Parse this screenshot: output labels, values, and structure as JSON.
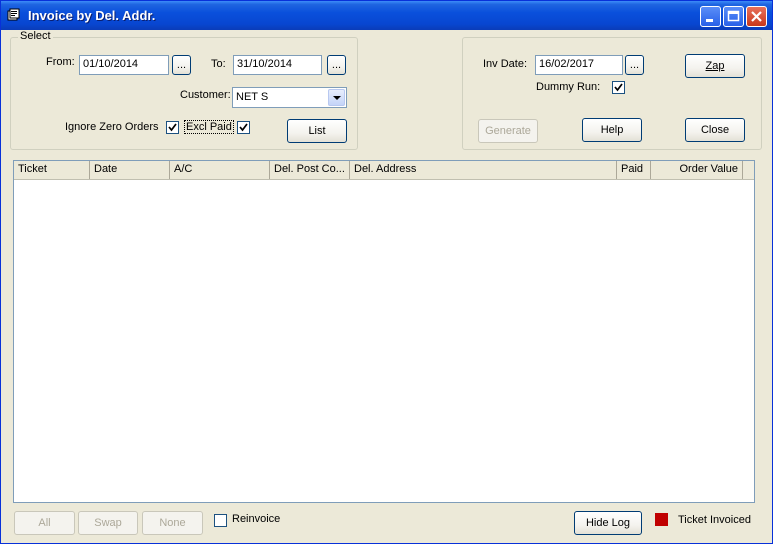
{
  "window": {
    "title": "Invoice by Del. Addr."
  },
  "select_group": {
    "legend": "Select",
    "from_label": "From:",
    "from_value": "01/10/2014",
    "to_label": "To:",
    "to_value": "31/10/2014",
    "browse_label": "...",
    "customer_label": "Customer:",
    "customer_value": "NET S",
    "ignore_zero_label": "Ignore Zero Orders",
    "ignore_zero_checked": true,
    "excl_paid_label": "Excl Paid",
    "excl_paid_checked": true,
    "list_button": "List"
  },
  "right_group": {
    "inv_date_label": "Inv Date:",
    "inv_date_value": "16/02/2017",
    "browse_label": "...",
    "dummy_run_label": "Dummy Run:",
    "dummy_run_checked": true,
    "zap_button": "Zap",
    "generate_button": "Generate",
    "help_button": "Help",
    "close_button": "Close"
  },
  "grid": {
    "columns": [
      "Ticket",
      "Date",
      "A/C",
      "Del. Post Co...",
      "Del. Address",
      "Paid",
      "Order Value"
    ],
    "rows": []
  },
  "bottom": {
    "all_button": "All",
    "swap_button": "Swap",
    "none_button": "None",
    "reinvoice_label": "Reinvoice",
    "reinvoice_checked": false,
    "hide_log_button": "Hide Log",
    "legend_label": "Ticket Invoiced",
    "legend_color": "#C00000"
  }
}
